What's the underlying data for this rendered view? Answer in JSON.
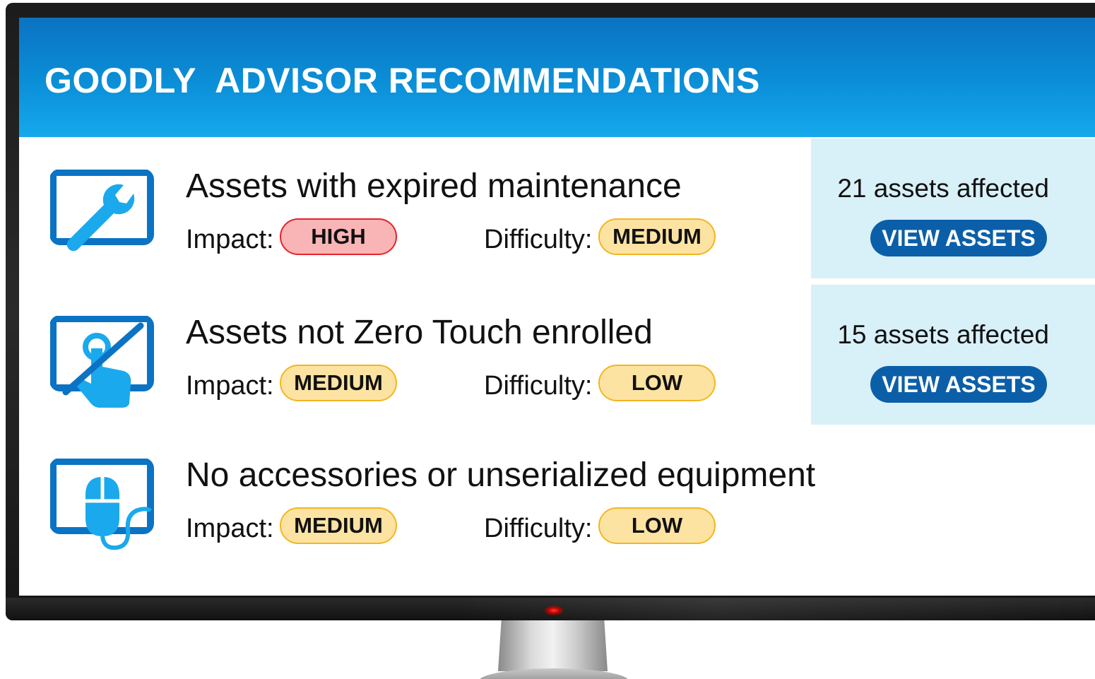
{
  "header": {
    "brand": "GOODLY",
    "title": "ADVISOR RECOMMENDATIONS"
  },
  "labels": {
    "impact": "Impact:",
    "difficulty": "Difficulty:"
  },
  "recommendations": [
    {
      "title": "Assets with expired maintenance",
      "impact": "HIGH",
      "difficulty": "MEDIUM",
      "icon": "wrench-monitor-icon",
      "affected": "21 assets affected",
      "action": "VIEW ASSETS"
    },
    {
      "title": "Assets not Zero Touch enrolled",
      "impact": "MEDIUM",
      "difficulty": "LOW",
      "icon": "touch-disabled-monitor-icon",
      "affected": "15 assets affected",
      "action": "VIEW ASSETS"
    },
    {
      "title": "No accessories or unserialized equipment",
      "impact": "MEDIUM",
      "difficulty": "LOW",
      "icon": "mouse-monitor-icon"
    }
  ],
  "colors": {
    "header_top": "#0a73c2",
    "header_bottom": "#16a9ec",
    "panel": "#d8f0f8",
    "button": "#0b5fa8",
    "icon_blue": "#0b73c4",
    "icon_light": "#1aa9ec",
    "high_fill": "#f9b4b6",
    "high_border": "#e5232b",
    "medium_fill": "#fde3a2",
    "medium_border": "#f2b623"
  }
}
